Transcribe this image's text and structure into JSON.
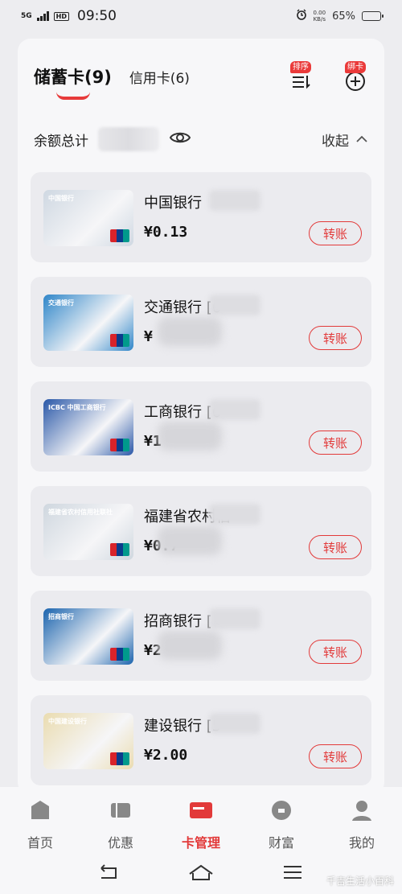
{
  "status_bar": {
    "network": "5G",
    "hd": "HD",
    "time": "09:50",
    "net_speed": "0.00\nKB/s",
    "battery": "65%",
    "battery_level": 0.65
  },
  "tabs": {
    "savings": "储蓄卡(9)",
    "credit": "信用卡(6)"
  },
  "toolbar": {
    "sort_badge": "排序",
    "bind_badge": "绑卡"
  },
  "balance": {
    "label": "余额总计",
    "collapse_label": "收起"
  },
  "cards": [
    {
      "name": "中国银行",
      "name_tail": "",
      "amount": "¥0.13",
      "button": "转账",
      "bg": "#cfd8e2",
      "logo_text": "中国银行",
      "has_blur_amount": false
    },
    {
      "name": "交通银行",
      "name_tail": " [6",
      "amount": "¥",
      "button": "转账",
      "bg": "#2f86c9",
      "logo_text": "交通银行",
      "has_blur_amount": true
    },
    {
      "name": "工商银行",
      "name_tail": " [6",
      "amount": "¥1",
      "button": "转账",
      "bg": "#2a58a8",
      "logo_text": "ICBC 中国工商银行",
      "has_blur_amount": true
    },
    {
      "name": "福建省农村信··",
      "name_tail": "",
      "amount": "¥0.7",
      "button": "转账",
      "bg": "#cfd7df",
      "logo_text": "福建省农村信用社联社",
      "has_blur_amount": true
    },
    {
      "name": "招商银行",
      "name_tail": " [",
      "amount": "¥2",
      "button": "转账",
      "bg": "#1b64ae",
      "logo_text": "招商银行",
      "has_blur_amount": true
    },
    {
      "name": "建设银行",
      "name_tail": " [5",
      "amount": "¥2.00",
      "button": "转账",
      "bg": "#eadcb0",
      "logo_text": "中国建设银行",
      "has_blur_amount": false
    }
  ],
  "bottom_nav": [
    {
      "label": "首页",
      "icon": "home-icon",
      "active": false
    },
    {
      "label": "优惠",
      "icon": "coupon-icon",
      "active": false
    },
    {
      "label": "卡管理",
      "icon": "card-manage-icon",
      "active": true
    },
    {
      "label": "财富",
      "icon": "wealth-icon",
      "active": false
    },
    {
      "label": "我的",
      "icon": "profile-icon",
      "active": false
    }
  ],
  "watermark": "千吉生活小百科",
  "colors": {
    "accent": "#e23a3a",
    "sheet": "#f7f7f9",
    "card": "#ebebef"
  }
}
